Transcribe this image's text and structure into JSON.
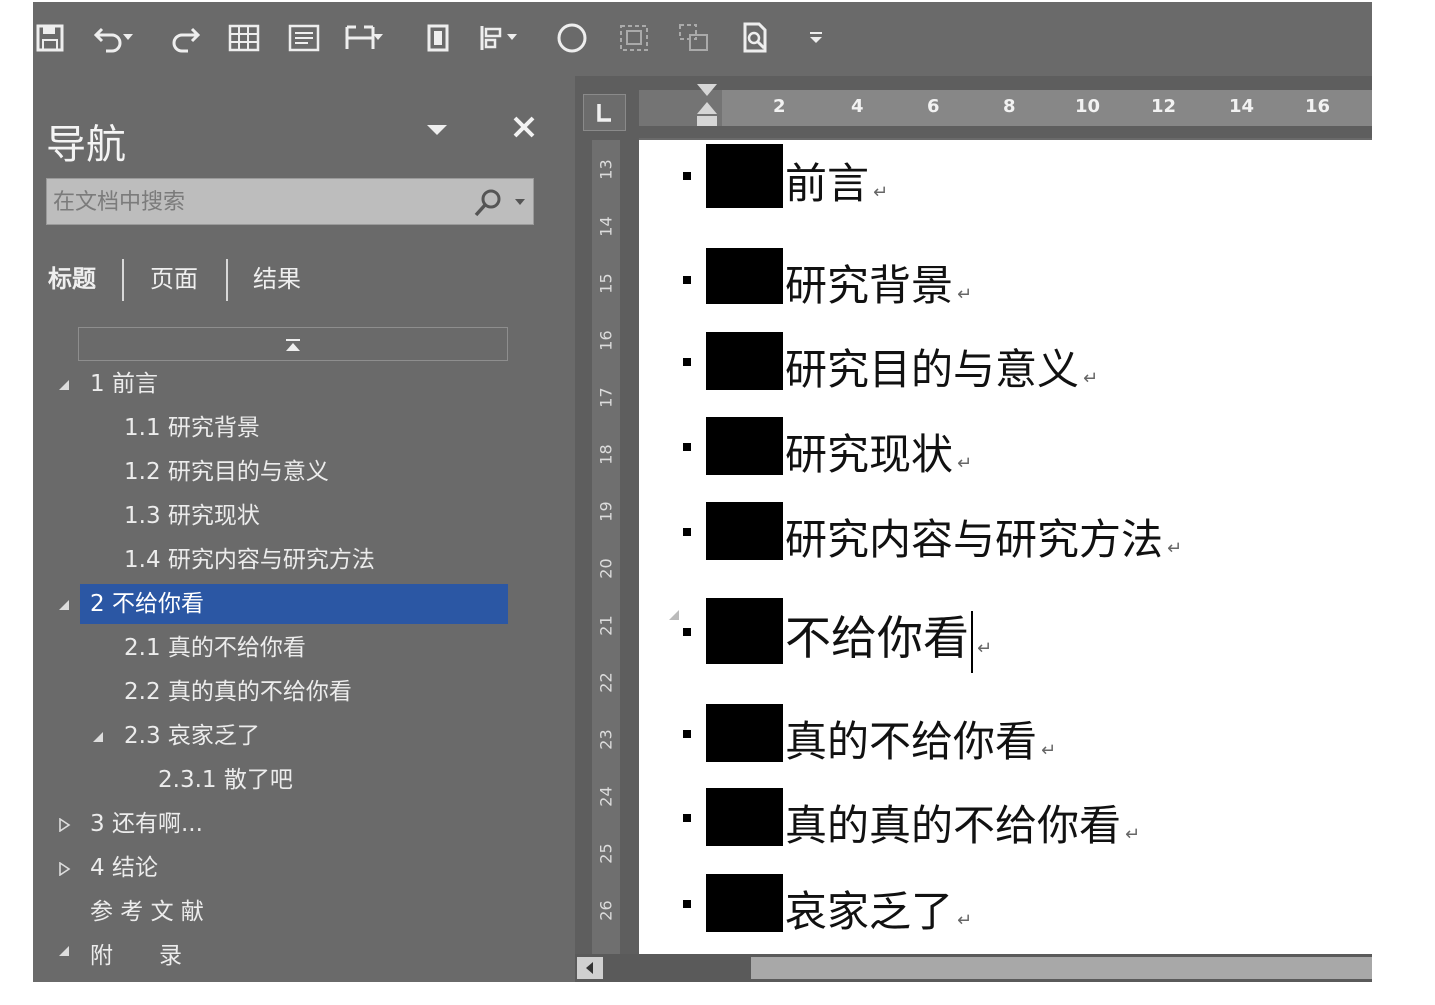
{
  "toolbar": {
    "buttons": [
      "save-icon",
      "undo-icon",
      "redo-icon",
      "table-icon",
      "text-box-icon",
      "columns-icon",
      "page-size-icon",
      "align-icon",
      "circle-shape-icon",
      "group-icon",
      "ungroup-icon",
      "print-preview-icon",
      "customize-toolbar-icon"
    ]
  },
  "nav": {
    "title": "导航",
    "search_placeholder": "在文档中搜索",
    "tabs": [
      "标题",
      "页面",
      "结果"
    ],
    "items": [
      {
        "label": "1 前言"
      },
      {
        "label": "1.1 研究背景"
      },
      {
        "label": "1.2 研究目的与意义"
      },
      {
        "label": "1.3 研究现状"
      },
      {
        "label": "1.4 研究内容与研究方法"
      },
      {
        "label": "2 不给你看"
      },
      {
        "label": "2.1 真的不给你看"
      },
      {
        "label": "2.2 真的真的不给你看"
      },
      {
        "label": "2.3 哀家乏了"
      },
      {
        "label": "2.3.1 散了吧"
      },
      {
        "label": "3 还有啊..."
      },
      {
        "label": "4 结论"
      },
      {
        "label": "参 考 文 献"
      },
      {
        "label": "附　　录"
      }
    ]
  },
  "ruler": {
    "tab_selector": "L",
    "h_numbers": [
      "2",
      "4",
      "6",
      "8",
      "10",
      "12",
      "14",
      "16"
    ],
    "v_numbers": [
      "13",
      "14",
      "15",
      "16",
      "17",
      "18",
      "19",
      "20",
      "21",
      "22",
      "23",
      "24",
      "25",
      "26"
    ]
  },
  "document": {
    "headings": [
      {
        "text": "前言"
      },
      {
        "text": "研究背景"
      },
      {
        "text": "研究目的与意义"
      },
      {
        "text": "研究现状"
      },
      {
        "text": "研究内容与研究方法"
      },
      {
        "text": "不给你看"
      },
      {
        "text": "真的不给你看"
      },
      {
        "text": "真的真的不给你看"
      },
      {
        "text": "哀家乏了"
      }
    ],
    "paragraph_mark": "↵"
  },
  "colors": {
    "chrome_bg": "#6a6a6a",
    "selection": "#2b57a4",
    "page": "#ffffff"
  }
}
